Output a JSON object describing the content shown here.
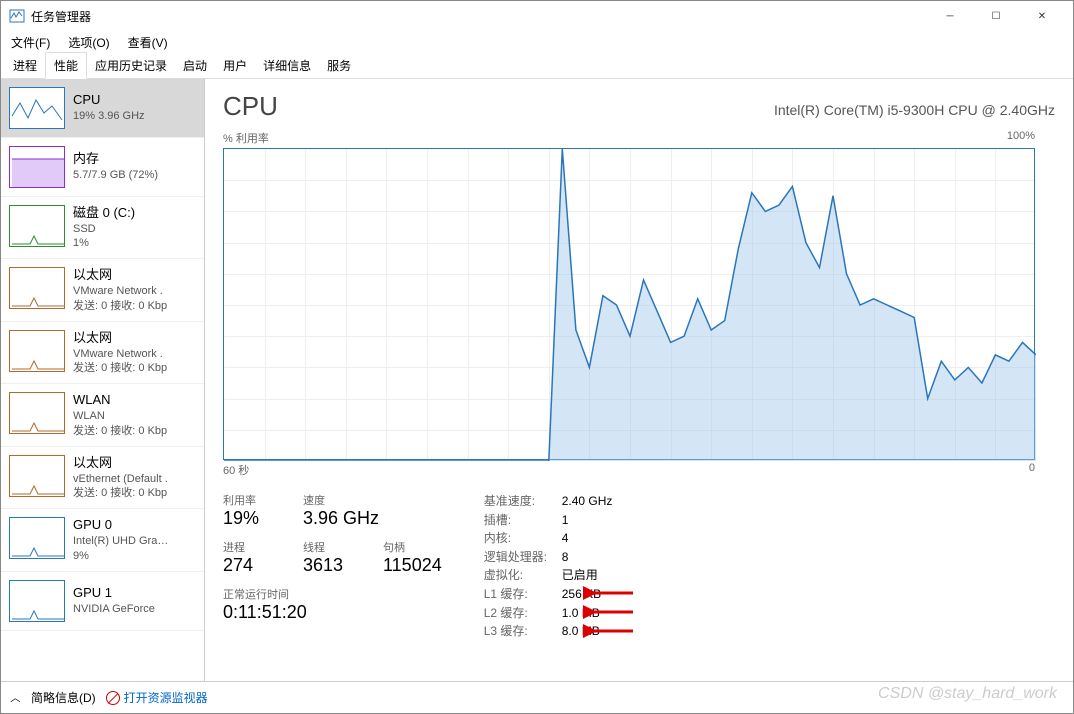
{
  "window": {
    "title": "任务管理器"
  },
  "menu": {
    "file": "文件(F)",
    "options": "选项(O)",
    "view": "查看(V)"
  },
  "tabs": {
    "proc": "进程",
    "perf": "性能",
    "apphist": "应用历史记录",
    "startup": "启动",
    "users": "用户",
    "details": "详细信息",
    "services": "服务"
  },
  "sidebar": [
    {
      "title": "CPU",
      "sub": "19% 3.96 GHz",
      "color": "#2976bb",
      "selected": true
    },
    {
      "title": "内存",
      "sub": "5.7/7.9 GB (72%)",
      "color": "#8a2be2"
    },
    {
      "title": "磁盘 0 (C:)",
      "sub": "SSD",
      "sub2": "1%",
      "color": "#2e8b2e"
    },
    {
      "title": "以太网",
      "sub": "VMware Network .",
      "sub2": "发送: 0 接收: 0 Kbp",
      "color": "#b06a2c"
    },
    {
      "title": "以太网",
      "sub": "VMware Network .",
      "sub2": "发送: 0 接收: 0 Kbp",
      "color": "#b06a2c"
    },
    {
      "title": "WLAN",
      "sub": "WLAN",
      "sub2": "发送: 0 接收: 0 Kbp",
      "color": "#b06a2c"
    },
    {
      "title": "以太网",
      "sub": "vEthernet (Default .",
      "sub2": "发送: 0 接收: 0 Kbp",
      "color": "#b06a2c"
    },
    {
      "title": "GPU 0",
      "sub": "Intel(R) UHD Gra…",
      "sub2": "9%",
      "color": "#2976bb"
    },
    {
      "title": "GPU 1",
      "sub": "NVIDIA GeForce",
      "color": "#2976bb"
    }
  ],
  "header": {
    "name": "CPU",
    "model": "Intel(R) Core(TM) i5-9300H CPU @ 2.40GHz"
  },
  "chart_meta": {
    "ylabel": "% 利用率",
    "ymax": "100%",
    "xleft": "60 秒",
    "xright": "0"
  },
  "chart_data": {
    "type": "area",
    "xlabel": "seconds (60→0)",
    "ylabel": "% Utilization",
    "ylim": [
      0,
      100
    ],
    "x": [
      0,
      1,
      2,
      3,
      4,
      5,
      6,
      7,
      8,
      9,
      10,
      11,
      12,
      13,
      14,
      15,
      16,
      17,
      18,
      19,
      20,
      21,
      22,
      23,
      24,
      25,
      26,
      27,
      28,
      29,
      30,
      31,
      32,
      33,
      34,
      35,
      36,
      37,
      38,
      39,
      40,
      41,
      42,
      43,
      44,
      45,
      46,
      47,
      48,
      49,
      50,
      51,
      52,
      53,
      54,
      55,
      56,
      57,
      58,
      59,
      60
    ],
    "values": [
      0,
      0,
      0,
      0,
      0,
      0,
      0,
      0,
      0,
      0,
      0,
      0,
      0,
      0,
      0,
      0,
      0,
      0,
      0,
      0,
      0,
      0,
      0,
      0,
      0,
      100,
      42,
      30,
      53,
      50,
      40,
      58,
      48,
      38,
      40,
      52,
      42,
      45,
      68,
      86,
      80,
      82,
      88,
      70,
      62,
      85,
      60,
      50,
      52,
      50,
      48,
      46,
      20,
      32,
      26,
      30,
      25,
      34,
      32,
      38,
      34
    ]
  },
  "stats": {
    "util_label": "利用率",
    "util": "19%",
    "speed_label": "速度",
    "speed": "3.96 GHz",
    "procs_label": "进程",
    "procs": "274",
    "threads_label": "线程",
    "threads": "3613",
    "handles_label": "句柄",
    "handles": "115024",
    "uptime_label": "正常运行时间",
    "uptime": "0:11:51:20"
  },
  "specs": {
    "base_label": "基准速度:",
    "base": "2.40 GHz",
    "sockets_label": "插槽:",
    "sockets": "1",
    "cores_label": "内核:",
    "cores": "4",
    "lprocs_label": "逻辑处理器:",
    "lprocs": "8",
    "virt_label": "虚拟化:",
    "virt": "已启用",
    "l1_label": "L1 缓存:",
    "l1": "256 KB",
    "l2_label": "L2 缓存:",
    "l2": "1.0 MB",
    "l3_label": "L3 缓存:",
    "l3": "8.0 MB"
  },
  "footer": {
    "brief": "简略信息(D)",
    "resmon": "打开资源监视器"
  },
  "watermark": "CSDN @stay_hard_work"
}
